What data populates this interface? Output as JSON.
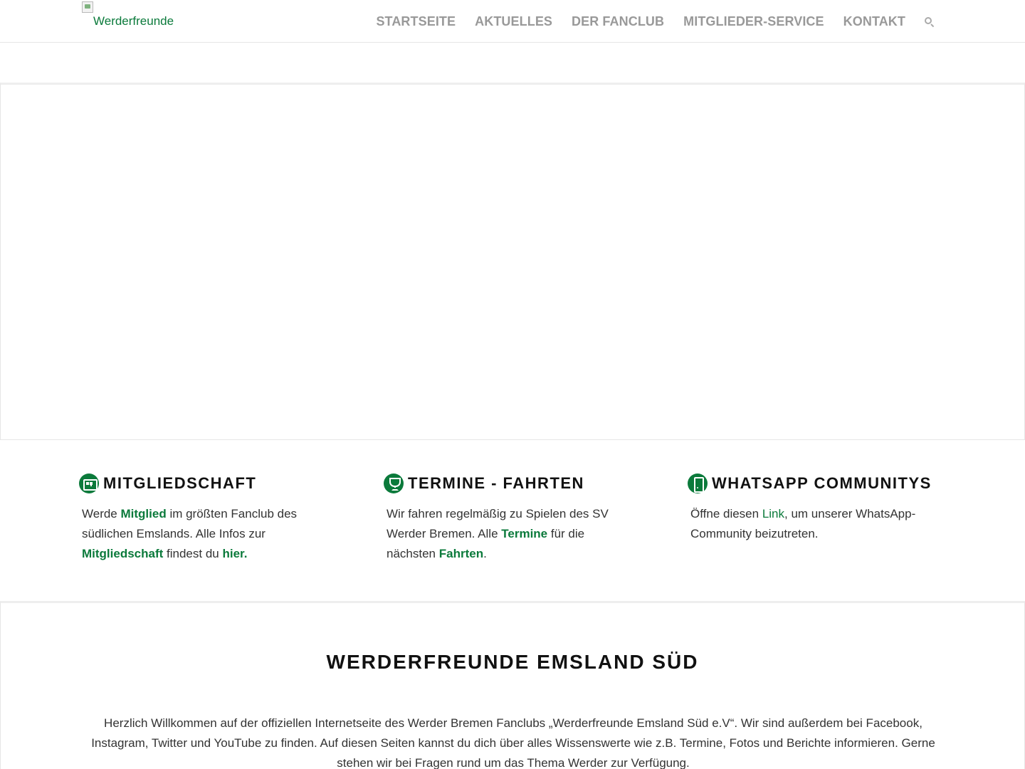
{
  "header": {
    "logo_alt": "Werderfreunde",
    "nav": [
      {
        "label": "STARTSEITE"
      },
      {
        "label": "AKTUELLES"
      },
      {
        "label": "DER FANCLUB"
      },
      {
        "label": "MITGLIEDER-SERVICE"
      },
      {
        "label": "KONTAKT"
      }
    ],
    "search_icon": "search-icon"
  },
  "features": [
    {
      "icon": "member-card-icon",
      "title": "MITGLIEDSCHAFT",
      "body": {
        "t1": "Werde ",
        "link1": "Mitglied",
        "t2": " im größten Fanclub des südlichen Emslands. Alle Infos zur ",
        "link2": "Mitgliedschaft",
        "t3": " findest du ",
        "link3": "hier."
      }
    },
    {
      "icon": "trophy-icon",
      "title": "TERMINE - FAHRTEN",
      "body": {
        "t1": "Wir fahren regelmäßig zu Spielen des SV Werder Bremen. Alle ",
        "link1": "Termine",
        "t2": " für die nächsten ",
        "link2": "Fahrten",
        "t3": "."
      }
    },
    {
      "icon": "phone-icon",
      "title": "WHATSAPP COMMUNITYS",
      "body": {
        "t1": "Öffne diesen ",
        "link1": "Link",
        "t2": ", um unserer WhatsApp-Community beizutreten."
      }
    }
  ],
  "welcome": {
    "title": "WERDERFREUNDE EMSLAND SÜD",
    "text": "Herzlich Willkommen auf der offiziellen Internetseite des Werder Bremen Fanclubs „Werderfreunde Emsland Süd e.V“. Wir sind außerdem bei Facebook, Instagram, Twitter und YouTube zu finden. Auf diesen Seiten kannst du dich über alles Wissenswerte wie z.B. Termine, Fotos und Berichte informieren. Gerne stehen wir bei Fragen rund um das Thema Werder zur Verfügung."
  },
  "colors": {
    "accent": "#0b7a3b",
    "nav_text": "#999999",
    "heading": "#111111",
    "body_text": "#333333"
  }
}
